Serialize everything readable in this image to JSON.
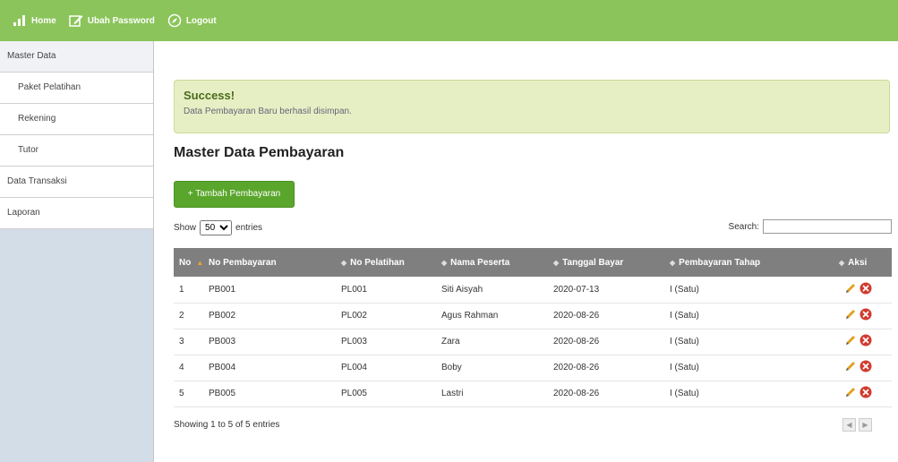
{
  "nav": {
    "home": "Home",
    "change_password": "Ubah Password",
    "logout": "Logout"
  },
  "sidebar": {
    "master_data": "Master Data",
    "items": [
      "Paket Pelatihan",
      "Rekening",
      "Tutor"
    ],
    "data_transaksi": "Data Transaksi",
    "laporan": "Laporan"
  },
  "alert": {
    "title": "Success!",
    "message": "Data Pembayaran Baru berhasil disimpan."
  },
  "page_title": "Master Data Pembayaran",
  "add_button": "+ Tambah Pembayaran",
  "length": {
    "show": "Show",
    "selected": "50",
    "entries": "entries"
  },
  "search": {
    "label": "Search:",
    "value": ""
  },
  "table": {
    "headers": [
      "No",
      "No Pembayaran",
      "No Pelatihan",
      "Nama Peserta",
      "Tanggal Bayar",
      "Pembayaran Tahap",
      "Aksi"
    ],
    "rows": [
      [
        "1",
        "PB001",
        "PL001",
        "Siti Aisyah",
        "2020-07-13",
        "I (Satu)"
      ],
      [
        "2",
        "PB002",
        "PL002",
        "Agus Rahman",
        "2020-08-26",
        "I (Satu)"
      ],
      [
        "3",
        "PB003",
        "PL003",
        "Zara",
        "2020-08-26",
        "I (Satu)"
      ],
      [
        "4",
        "PB004",
        "PL004",
        "Boby",
        "2020-08-26",
        "I (Satu)"
      ],
      [
        "5",
        "PB005",
        "PL005",
        "Lastri",
        "2020-08-26",
        "I (Satu)"
      ]
    ]
  },
  "info": "Showing 1 to 5 of 5 entries",
  "colors": {
    "topbar": "#8bc45a",
    "button": "#5aa62c",
    "alert_bg": "#e6efc4",
    "header_bg": "#7f7f7f",
    "delete": "#d13a2e",
    "edit": "#e0a020"
  },
  "icons": {
    "home": "bar-chart-icon",
    "change_password": "edit-icon",
    "logout": "compass-icon",
    "edit_row": "pencil-icon",
    "delete_row": "delete-icon"
  }
}
